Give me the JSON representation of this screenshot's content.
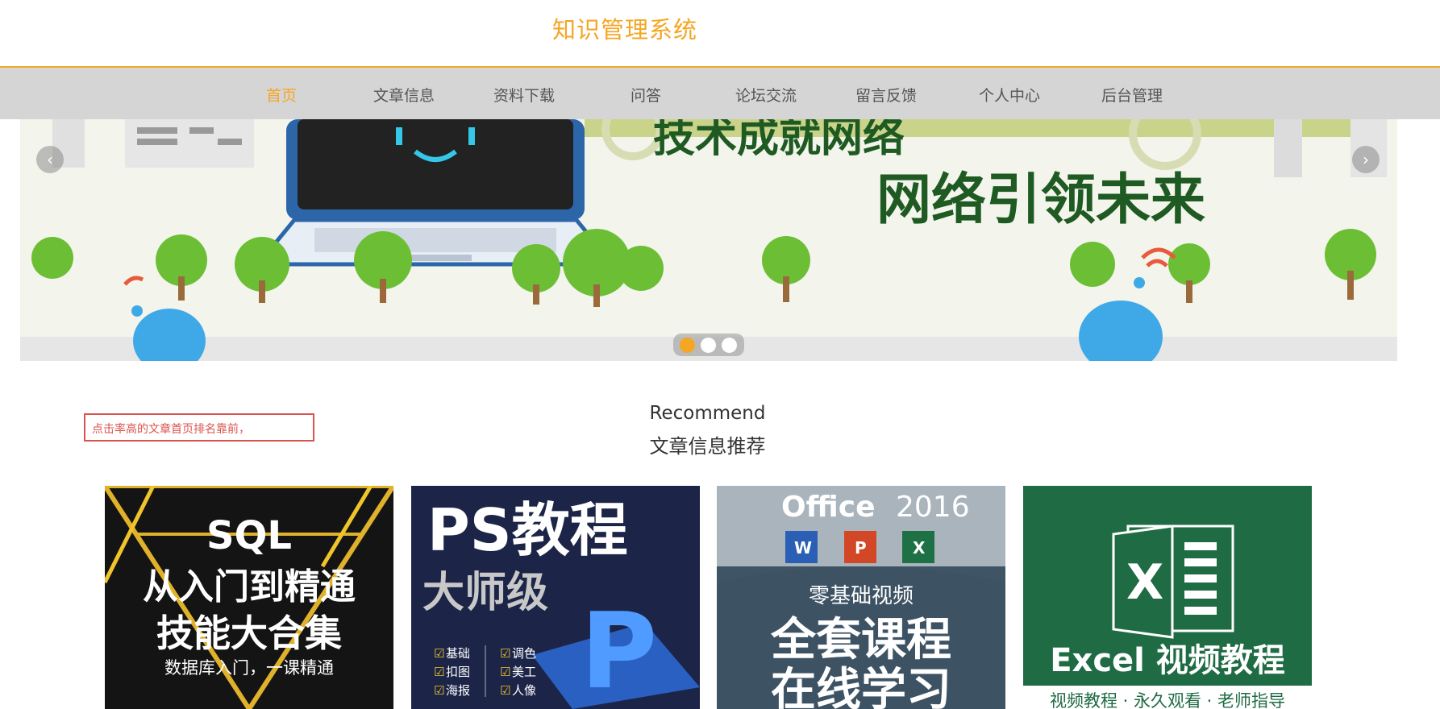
{
  "header": {
    "title": "知识管理系统"
  },
  "nav": {
    "items": [
      {
        "label": "首页",
        "active": true
      },
      {
        "label": "文章信息",
        "active": false
      },
      {
        "label": "资料下载",
        "active": false
      },
      {
        "label": "问答",
        "active": false
      },
      {
        "label": "论坛交流",
        "active": false
      },
      {
        "label": "留言反馈",
        "active": false
      },
      {
        "label": "个人中心",
        "active": false
      },
      {
        "label": "后台管理",
        "active": false
      }
    ]
  },
  "banner": {
    "heading_top": "技术成就网络",
    "heading_main": "网络引领未来",
    "prev_icon": "chevron-left-icon",
    "next_icon": "chevron-right-icon",
    "prev_glyph": "‹",
    "next_glyph": "›",
    "slide_count": 3,
    "active_slide": 1
  },
  "recommend": {
    "title_en": "Recommend",
    "title_cn": "文章信息推荐",
    "note": "点击率高的文章首页排名靠前，"
  },
  "cards": [
    {
      "line1": "SQL",
      "line2": "从入门到精通",
      "line3": "技能大合集",
      "line4": "数据库入门，一课精通"
    },
    {
      "line1": "PS教程",
      "line2": "大师级",
      "tags": [
        "基础",
        "扣图",
        "海报",
        "调色",
        "美工",
        "人像"
      ]
    },
    {
      "line1": "Office",
      "line1b": "2016",
      "line2": "零基础视频",
      "line3": "全套课程",
      "line4": "在线学习"
    },
    {
      "line1": "Excel 视频教程",
      "line2": "视频教程 · 永久观看 · 老师指导"
    }
  ],
  "colors": {
    "accent": "#f5a623",
    "nav_bg": "#d5d5d5",
    "note_border": "#d9534f"
  }
}
